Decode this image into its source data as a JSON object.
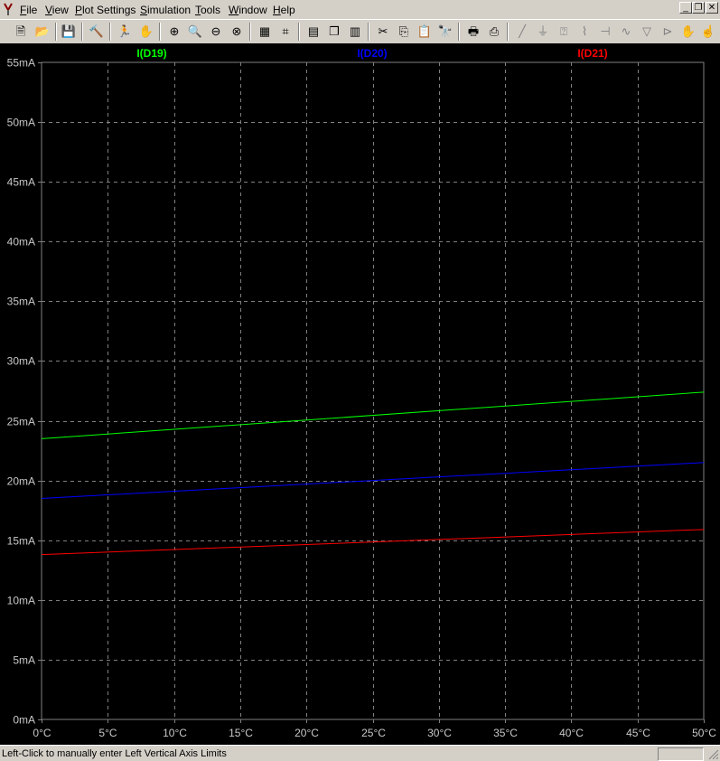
{
  "menu": {
    "items": [
      {
        "name": "menu-file",
        "label": "File"
      },
      {
        "name": "menu-view",
        "label": "View"
      },
      {
        "name": "menu-plot-settings",
        "label": "Plot Settings"
      },
      {
        "name": "menu-simulation",
        "label": "Simulation"
      },
      {
        "name": "menu-tools",
        "label": "Tools"
      },
      {
        "name": "menu-window",
        "label": "Window"
      },
      {
        "name": "menu-help",
        "label": "Help"
      }
    ]
  },
  "window_controls": {
    "minimize": "_",
    "restore": "❐",
    "close": "✕"
  },
  "toolbar": {
    "buttons": [
      {
        "name": "new-schematic-icon",
        "glyph": "🗎"
      },
      {
        "name": "open-folder-icon",
        "glyph": "📂"
      },
      {
        "name": "save-icon",
        "glyph": "💾"
      },
      {
        "name": "control-panel-icon",
        "glyph": "🔨"
      },
      {
        "name": "run-icon",
        "glyph": "🏃"
      },
      {
        "name": "halt-icon",
        "glyph": "✋"
      },
      {
        "name": "zoom-area-icon",
        "glyph": "⊕"
      },
      {
        "name": "pan-icon",
        "glyph": "🔍"
      },
      {
        "name": "zoom-out-icon",
        "glyph": "⊖"
      },
      {
        "name": "zoom-full-icon",
        "glyph": "⊗"
      },
      {
        "name": "autorange-icon",
        "glyph": "▦"
      },
      {
        "name": "pick-visible-traces-icon",
        "glyph": "⌗"
      },
      {
        "name": "tile-horizontal-icon",
        "glyph": "▤"
      },
      {
        "name": "cascade-icon",
        "glyph": "❐"
      },
      {
        "name": "tile-vertical-icon",
        "glyph": "▥"
      },
      {
        "name": "cut-icon",
        "glyph": "✂"
      },
      {
        "name": "copy-icon",
        "glyph": "⎘"
      },
      {
        "name": "paste-icon",
        "glyph": "📋"
      },
      {
        "name": "find-icon",
        "glyph": "🔭"
      },
      {
        "name": "print-setup-icon",
        "glyph": "🖶"
      },
      {
        "name": "print-icon",
        "glyph": "⎙"
      },
      {
        "name": "wire-icon",
        "glyph": "╱"
      },
      {
        "name": "ground-icon",
        "glyph": "⏚"
      },
      {
        "name": "label-net-icon",
        "glyph": "⍰"
      },
      {
        "name": "resistor-icon",
        "glyph": "⌇"
      },
      {
        "name": "capacitor-icon",
        "glyph": "⊣"
      },
      {
        "name": "inductor-icon",
        "glyph": "∿"
      },
      {
        "name": "diode-icon",
        "glyph": "▽"
      },
      {
        "name": "component-icon",
        "glyph": "⊳"
      },
      {
        "name": "move-icon",
        "glyph": "✋"
      },
      {
        "name": "drag-icon",
        "glyph": "☝"
      }
    ]
  },
  "status": {
    "text": "Left-Click to manually enter Left Vertical Axis Limits"
  },
  "colors": {
    "background": "#000000",
    "grid": "#808080",
    "axis_text": "#c8c8c8",
    "window": "#d4d0c8"
  },
  "chart_data": {
    "type": "line",
    "x_unit": "°C",
    "y_unit": "mA",
    "xlim": [
      0,
      50
    ],
    "ylim": [
      0,
      55
    ],
    "x_ticks": [
      "0°C",
      "5°C",
      "10°C",
      "15°C",
      "20°C",
      "25°C",
      "30°C",
      "35°C",
      "40°C",
      "45°C",
      "50°C"
    ],
    "y_ticks": [
      "0mA",
      "5mA",
      "10mA",
      "15mA",
      "20mA",
      "25mA",
      "30mA",
      "35mA",
      "40mA",
      "45mA",
      "50mA",
      "55mA"
    ],
    "grid": true,
    "legend_placement": "top",
    "series": [
      {
        "name": "I(D19)",
        "color": "#00ff00",
        "x": [
          0,
          50
        ],
        "y": [
          23.5,
          27.4
        ]
      },
      {
        "name": "I(D20)",
        "color": "#0000ff",
        "x": [
          0,
          50
        ],
        "y": [
          18.5,
          21.5
        ]
      },
      {
        "name": "I(D21)",
        "color": "#ff0000",
        "x": [
          0,
          50
        ],
        "y": [
          13.8,
          15.9
        ]
      }
    ]
  }
}
